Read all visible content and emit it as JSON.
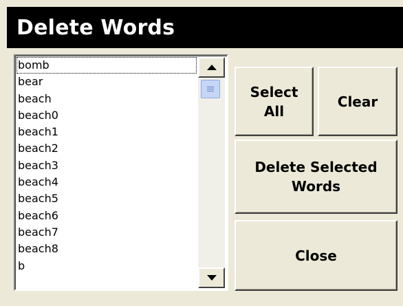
{
  "window": {
    "title": "Delete Words"
  },
  "word_list": {
    "items": [
      "bomb",
      "bear",
      "beach",
      "beach0",
      "beach1",
      "beach2",
      "beach3",
      "beach4",
      "beach5",
      "beach6",
      "beach7",
      "beach8",
      "b"
    ],
    "focused_index": 0
  },
  "buttons": {
    "select_all": "Select\nAll",
    "clear": "Clear",
    "delete_selected": "Delete Selected\nWords",
    "close": "Close"
  },
  "colors": {
    "titlebar_bg": "#000000",
    "window_bg": "#ece9d8",
    "scroll_thumb": "#c6d6f7"
  }
}
